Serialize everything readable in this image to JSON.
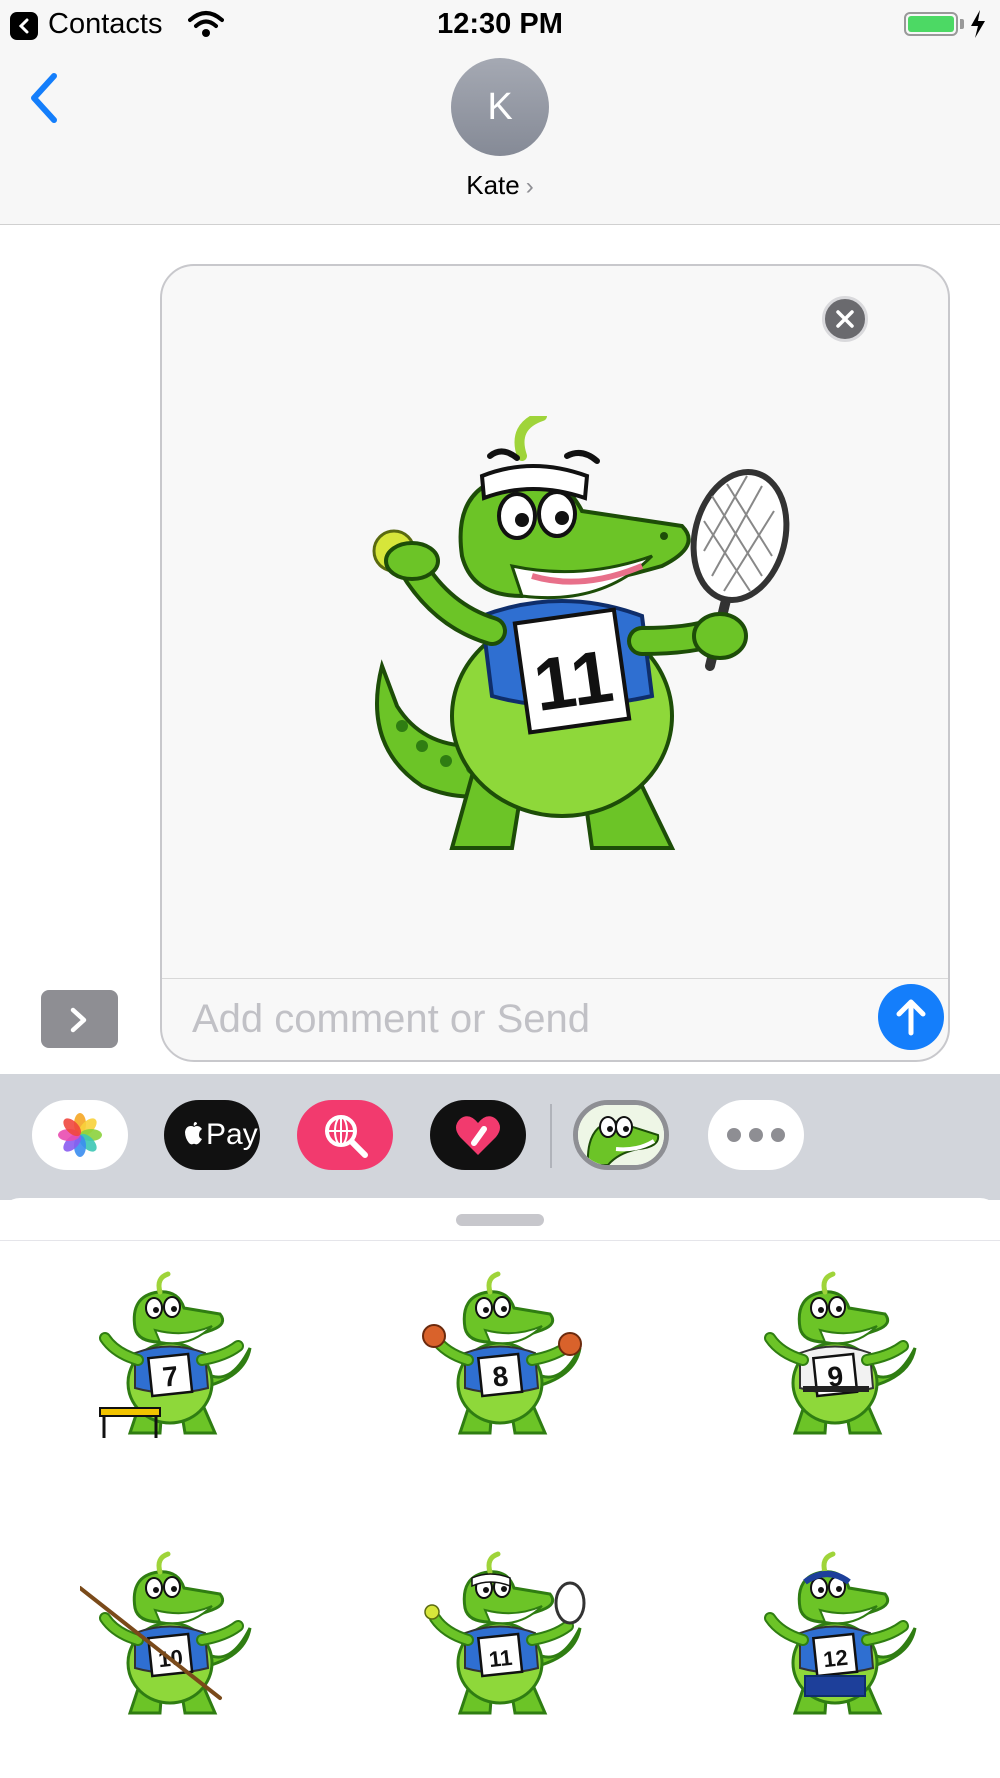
{
  "status_bar": {
    "back_label": "Contacts",
    "time": "12:30 PM",
    "battery_level": 1.0,
    "charging": true
  },
  "header": {
    "avatar_initial": "K",
    "contact_name": "Kate"
  },
  "compose": {
    "placeholder": "Add comment or Send",
    "attachment_sticker": {
      "number": "11",
      "sport": "tennis"
    }
  },
  "app_drawer": {
    "apps": [
      {
        "name": "Photos",
        "icon": "photos-icon"
      },
      {
        "name": "Apple Pay",
        "label": "Pay",
        "icon": "apple-pay-icon"
      },
      {
        "name": "Images search",
        "icon": "globe-search-icon"
      },
      {
        "name": "Digital Touch",
        "icon": "heart-touch-icon"
      },
      {
        "name": "Croc stickers",
        "icon": "croc-sticker-app-icon",
        "selected": true
      },
      {
        "name": "More",
        "icon": "more-icon"
      }
    ]
  },
  "stickers": [
    {
      "number": "7",
      "sport": "hurdles"
    },
    {
      "number": "8",
      "sport": "boxing"
    },
    {
      "number": "9",
      "sport": "judo"
    },
    {
      "number": "10",
      "sport": "pole vault"
    },
    {
      "number": "11",
      "sport": "tennis"
    },
    {
      "number": "12",
      "sport": "diving"
    }
  ],
  "colors": {
    "accent": "#147efb",
    "croc_green": "#6cc427",
    "croc_dark": "#2f7d12",
    "shirt_blue": "#2f6fd1",
    "nav_background": "#f7f7f7",
    "app_bar_background": "#d2d5db"
  }
}
